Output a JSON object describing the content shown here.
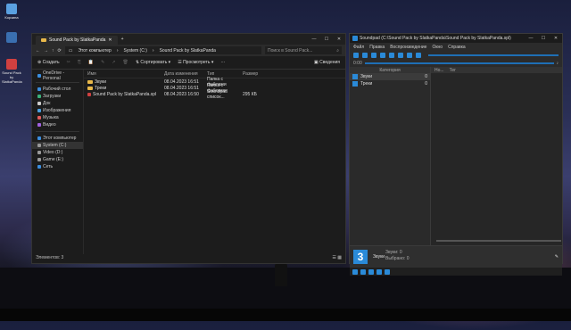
{
  "desktop": {
    "icons": [
      {
        "label": "Корзина",
        "color": "#5aa0e0"
      },
      {
        "label": "",
        "color": "#3a6fb0"
      },
      {
        "label": "Sound Pack by SlatkaPanda",
        "color": "#d04040"
      }
    ]
  },
  "explorer": {
    "tab_title": "Sound Pack by SlatkaPanda",
    "controls": {
      "minimize": "—",
      "maximize": "☐",
      "close": "✕"
    },
    "address": {
      "crumbs": [
        "Этот компьютер",
        "System (C:)",
        "Sound Pack by SlatkaPanda"
      ]
    },
    "search_placeholder": "Поиск в Sound Pack...",
    "toolbar": {
      "create": "Создать",
      "sort": "Сортировать",
      "view": "Просмотреть",
      "details": "Сведения"
    },
    "nav": [
      {
        "label": "OneDrive - Personal",
        "color": "#3a8ee0"
      },
      {
        "label": "Рабочий стол",
        "color": "#3a8ee0"
      },
      {
        "label": "Загрузки",
        "color": "#3ab07a"
      },
      {
        "label": "Док",
        "color": "#cccccc"
      },
      {
        "label": "Изображения",
        "color": "#4aa0e0"
      },
      {
        "label": "Музыка",
        "color": "#e05a5a"
      },
      {
        "label": "Видео",
        "color": "#a060e0"
      },
      {
        "label": "Этот компьютер",
        "color": "#3a8ee0"
      },
      {
        "label": "System (C:)",
        "color": "#999999"
      },
      {
        "label": "Video (D:)",
        "color": "#999999"
      },
      {
        "label": "Game (E:)",
        "color": "#999999"
      },
      {
        "label": "Сеть",
        "color": "#3a8ee0"
      }
    ],
    "columns": [
      "Имя",
      "Дата изменения",
      "Тип",
      "Размер"
    ],
    "rows": [
      {
        "name": "Звуки",
        "date": "08.04.2023 16:51",
        "type": "Папка с файлами",
        "size": ""
      },
      {
        "name": "Треки",
        "date": "08.04.2023 16:51",
        "type": "Папка с файлами",
        "size": ""
      },
      {
        "name": "Sound Pack by SlatkaPanda.spl",
        "date": "08.04.2023 16:50",
        "type": "Soundpad список...",
        "size": "295 КБ"
      }
    ],
    "status": "Элементов: 3"
  },
  "soundpad": {
    "title": "Soundpad (C:\\Sound Pack by SlatkaPanda\\Sound Pack by SlatkaPanda.spl)",
    "menu": [
      "Файл",
      "Правка",
      "Воспроизведение",
      "Окно",
      "Справка"
    ],
    "time": "0:00",
    "category_header": "Категория",
    "categories": [
      {
        "name": "Звуки",
        "count": "0"
      },
      {
        "name": "Треки",
        "count": "0"
      }
    ],
    "list_headers": [
      "Но...",
      "Тег"
    ],
    "info": {
      "number": "3",
      "name": "Звуки",
      "label_total": "Звуки:",
      "total": "0",
      "label_selected": "Выбрано:",
      "selected": "0"
    }
  }
}
